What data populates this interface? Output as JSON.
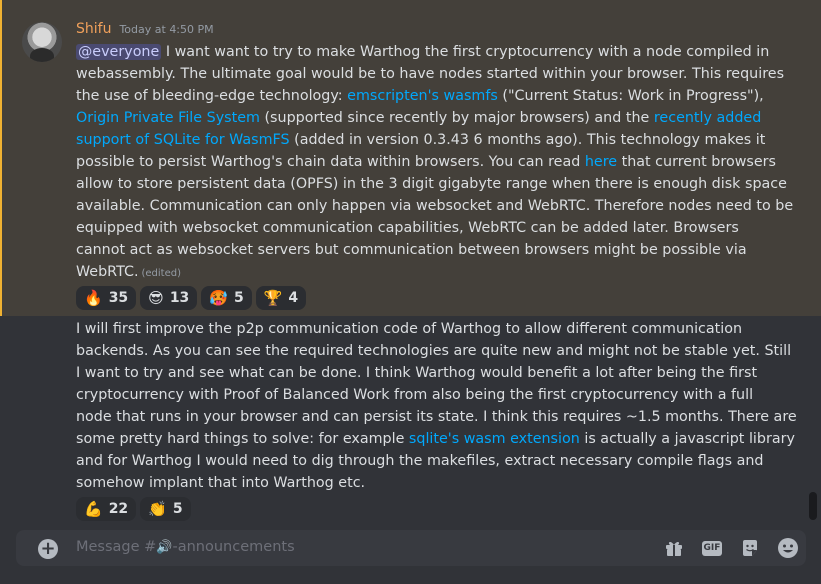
{
  "message1": {
    "author": "Shifu",
    "timestamp": "Today at 4:50 PM",
    "mention": "@everyone",
    "lines": [
      [
        {
          "t": "text",
          "v": " I want want to try to make Warthog the first cryptocurrency with a node compiled in"
        }
      ],
      [
        {
          "t": "text",
          "v": "webassembly. The ultimate goal would be to have nodes started within your browser. This requires"
        }
      ],
      [
        {
          "t": "text",
          "v": "the use of bleeding-edge technology: "
        },
        {
          "t": "link",
          "v": "emscripten's wasmfs"
        },
        {
          "t": "text",
          "v": " (\"Current Status: Work in Progress\"),"
        }
      ],
      [
        {
          "t": "link",
          "v": "Origin Private File System"
        },
        {
          "t": "text",
          "v": " (supported since recently by major browsers) and the "
        },
        {
          "t": "link",
          "v": "recently added"
        }
      ],
      [
        {
          "t": "link",
          "v": "support of SQLite for WasmFS"
        },
        {
          "t": "text",
          "v": " (added in version 0.3.43 6 months ago). This technology makes it"
        }
      ],
      [
        {
          "t": "text",
          "v": "possible to persist Warthog's chain data within browsers. You can read "
        },
        {
          "t": "link",
          "v": "here"
        },
        {
          "t": "text",
          "v": " that current browsers"
        }
      ],
      [
        {
          "t": "text",
          "v": "allow to store persistent data (OPFS) in the 3 digit gigabyte range when there is enough disk space"
        }
      ],
      [
        {
          "t": "text",
          "v": "available. Communication can only happen via websocket and WebRTC. Therefore nodes need to be"
        }
      ],
      [
        {
          "t": "text",
          "v": "equipped with websocket communication capabilities, WebRTC can be added later. Browsers"
        }
      ],
      [
        {
          "t": "text",
          "v": "cannot act as websocket servers but communication between browsers might be possible via"
        }
      ],
      [
        {
          "t": "text",
          "v": "WebRTC."
        }
      ]
    ],
    "edited_label": "(edited)",
    "reactions": [
      {
        "emoji": "🔥",
        "count": "35"
      },
      {
        "emoji": "😎",
        "count": "13"
      },
      {
        "emoji": "🥵",
        "count": "5"
      },
      {
        "emoji": "🏆",
        "count": "4"
      }
    ]
  },
  "message2": {
    "lines": [
      [
        {
          "t": "text",
          "v": "I will first improve the p2p communication code of Warthog to allow different communication"
        }
      ],
      [
        {
          "t": "text",
          "v": "backends. As you can see the required technologies are quite new and might not be stable yet. Still"
        }
      ],
      [
        {
          "t": "text",
          "v": "I want to try and see what can be done. I think Warthog would benefit a lot after being the first"
        }
      ],
      [
        {
          "t": "text",
          "v": "cryptocurrency with Proof of Balanced Work from also being the first cryptocurrency with a full"
        }
      ],
      [
        {
          "t": "text",
          "v": "node that runs in your browser and can persist its state. I think this requires ~1.5 months. There are"
        }
      ],
      [
        {
          "t": "text",
          "v": "some pretty hard things to solve: for example "
        },
        {
          "t": "link",
          "v": "sqlite's wasm extension"
        },
        {
          "t": "text",
          "v": " is actually a javascript library"
        }
      ],
      [
        {
          "t": "text",
          "v": "and for Warthog I would need to dig through the makefiles, extract necessary compile flags and"
        }
      ],
      [
        {
          "t": "text",
          "v": "somehow implant that into Warthog etc."
        }
      ]
    ],
    "reactions": [
      {
        "emoji": "💪",
        "count": "22"
      },
      {
        "emoji": "👏",
        "count": "5"
      }
    ]
  },
  "composer": {
    "placeholder_prefix": "Message #",
    "channel_icon": "🔊",
    "placeholder_suffix": "-announcements",
    "gif_label": "GIF"
  },
  "icons": {
    "add": "plus-circle-icon",
    "gift": "gift-icon",
    "gif": "gif-icon",
    "sticker": "sticker-icon",
    "emoji": "emoji-icon"
  },
  "colors": {
    "background": "#313338",
    "highlight": "#44403a",
    "highlight_bar": "#f0b232",
    "username": "#f0a05b",
    "link": "#00a8fc",
    "mention_bg": "rgba(88,101,242,0.3)"
  }
}
